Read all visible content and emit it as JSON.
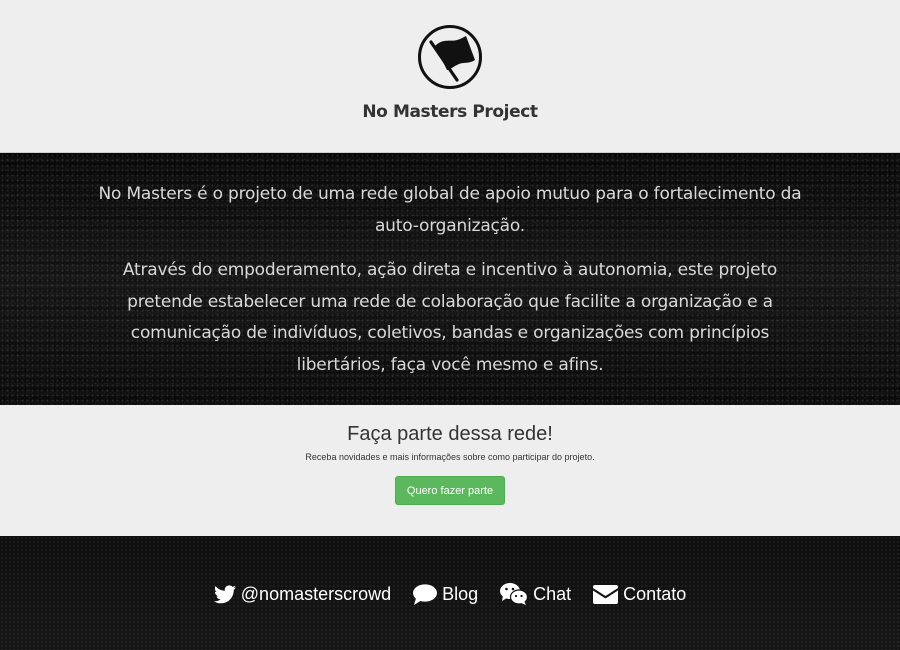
{
  "header": {
    "logo_icon": "black-flag-icon",
    "title": "No Masters Project"
  },
  "hero": {
    "paragraph_1": "No Masters é o projeto de uma rede global de apoio mutuo para o fortalecimento da auto-organização.",
    "paragraph_2": "Através do empoderamento, ação direta e incentivo à autonomia, este projeto pretende estabelecer uma rede de colaboração que facilite a organização e a comunicação de indivíduos, coletivos, bandas e organizações com princípios libertários, faça você mesmo e afins."
  },
  "signup": {
    "heading": "Faça parte dessa rede!",
    "subtext": "Receba novidades e mais informações sobre como participar do projeto.",
    "button_label": "Quero fazer parte",
    "button_color": "#5cb85c"
  },
  "footer": {
    "links": [
      {
        "icon": "twitter-icon",
        "label": "@nomasterscrowd"
      },
      {
        "icon": "speech-bubble-icon",
        "label": "Blog"
      },
      {
        "icon": "wechat-icon",
        "label": "Chat"
      },
      {
        "icon": "envelope-icon",
        "label": "Contato"
      }
    ]
  }
}
